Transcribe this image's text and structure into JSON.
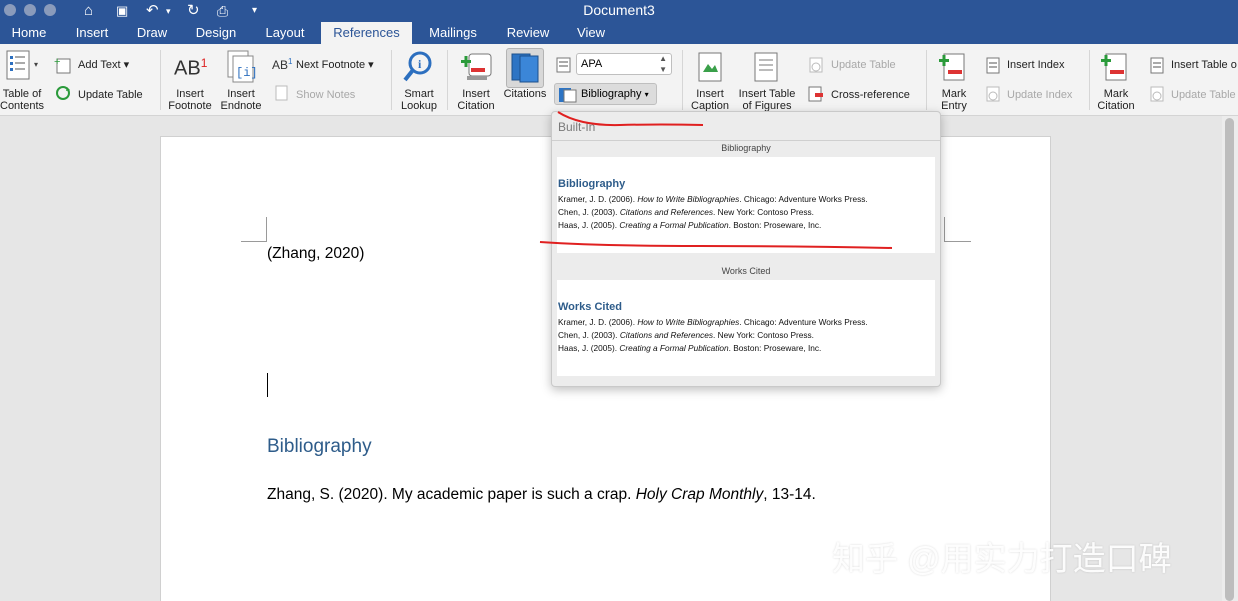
{
  "window": {
    "title": "Document3"
  },
  "tabs": [
    "Home",
    "Insert",
    "Draw",
    "Design",
    "Layout",
    "References",
    "Mailings",
    "Review",
    "View"
  ],
  "active_tab": "References",
  "ribbon": {
    "toc_label": "Table of\nContents",
    "add_text": "Add Text",
    "update_table": "Update Table",
    "insert_footnote": "Insert\nFootnote",
    "insert_endnote": "Insert\nEndnote",
    "next_footnote": "Next Footnote",
    "show_notes": "Show Notes",
    "smart_lookup": "Smart\nLookup",
    "insert_citation": "Insert\nCitation",
    "citations": "Citations",
    "style_value": "APA",
    "bibliography": "Bibliography",
    "insert_caption": "Insert\nCaption",
    "insert_table_of_figures": "Insert Table\nof Figures",
    "update_table_figures": "Update Table",
    "cross_reference": "Cross-reference",
    "mark_entry": "Mark\nEntry",
    "insert_index": "Insert Index",
    "update_index": "Update Index",
    "mark_citation": "Mark\nCitation",
    "insert_table_of_authorities": "Insert Table o",
    "update_table_authorities": "Update Table"
  },
  "document": {
    "citation": "(Zhang, 2020)",
    "bibliography_heading": "Bibliography",
    "reference_prefix": "Zhang, S. (2020). My academic paper is such a crap. ",
    "reference_journal": "Holy Crap Monthly",
    "reference_suffix": ", 13-14."
  },
  "bibliography_popup": {
    "section_header": "Built-In",
    "options": [
      {
        "caption": "Bibliography",
        "title": "Bibliography",
        "entries": [
          {
            "pre": "Kramer, J. D. (2006). ",
            "italic": "How to Write Bibliographies",
            "post": ". Chicago: Adventure Works Press."
          },
          {
            "pre": "Chen, J. (2003). ",
            "italic": "Citations and References",
            "post": ". New York: Contoso Press."
          },
          {
            "pre": "Haas, J. (2005). ",
            "italic": "Creating a Formal Publication",
            "post": ". Boston: Proseware, Inc."
          }
        ]
      },
      {
        "caption": "Works Cited",
        "title": "Works Cited",
        "entries": [
          {
            "pre": "Kramer, J. D. (2006). ",
            "italic": "How to Write Bibliographies",
            "post": ". Chicago: Adventure Works Press."
          },
          {
            "pre": "Chen, J. (2003). ",
            "italic": "Citations and References",
            "post": ". New York: Contoso Press."
          },
          {
            "pre": "Haas, J. (2005). ",
            "italic": "Creating a Formal Publication",
            "post": ". Boston: Proseware, Inc."
          }
        ]
      }
    ]
  },
  "watermark": "知乎 @用实力打造口碑",
  "colors": {
    "ribbon_blue": "#2c5597",
    "heading_blue": "#2e5c8a",
    "annotation_red": "#e02020"
  }
}
